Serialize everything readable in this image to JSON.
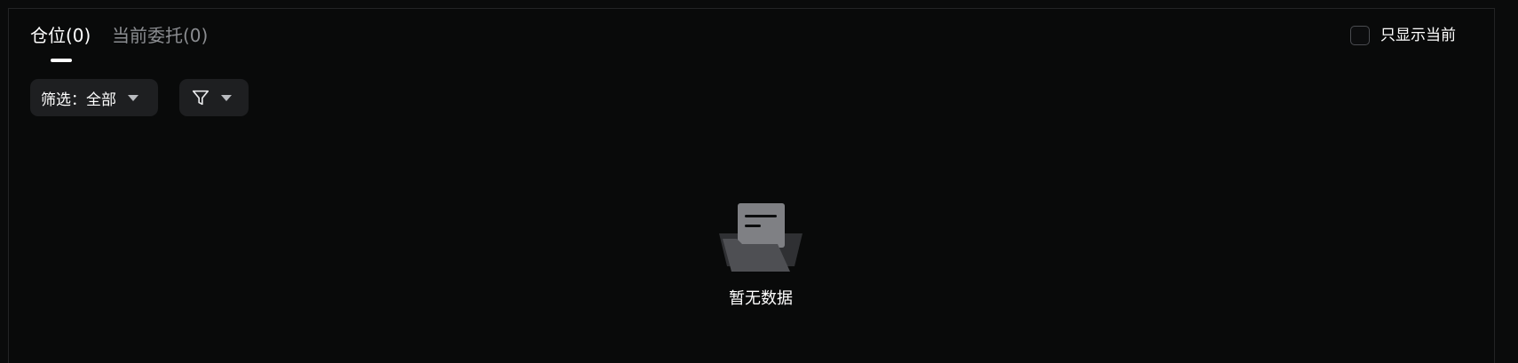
{
  "tabs": {
    "positions": "仓位(0)",
    "orders": "当前委托(0)"
  },
  "show_current": {
    "label": "只显示当前",
    "checked": false
  },
  "filters": {
    "scope_label": "筛选：全部",
    "scope_icon": "chevron-down-icon",
    "type_icon": "funnel-icon"
  },
  "empty_state": {
    "icon": "empty-folder-icon",
    "message": "暂无数据"
  },
  "colors": {
    "background": "#0a0b0b",
    "button_bg": "#1e1f21",
    "active_text": "#ffffff",
    "inactive_text": "#8b8d91"
  }
}
